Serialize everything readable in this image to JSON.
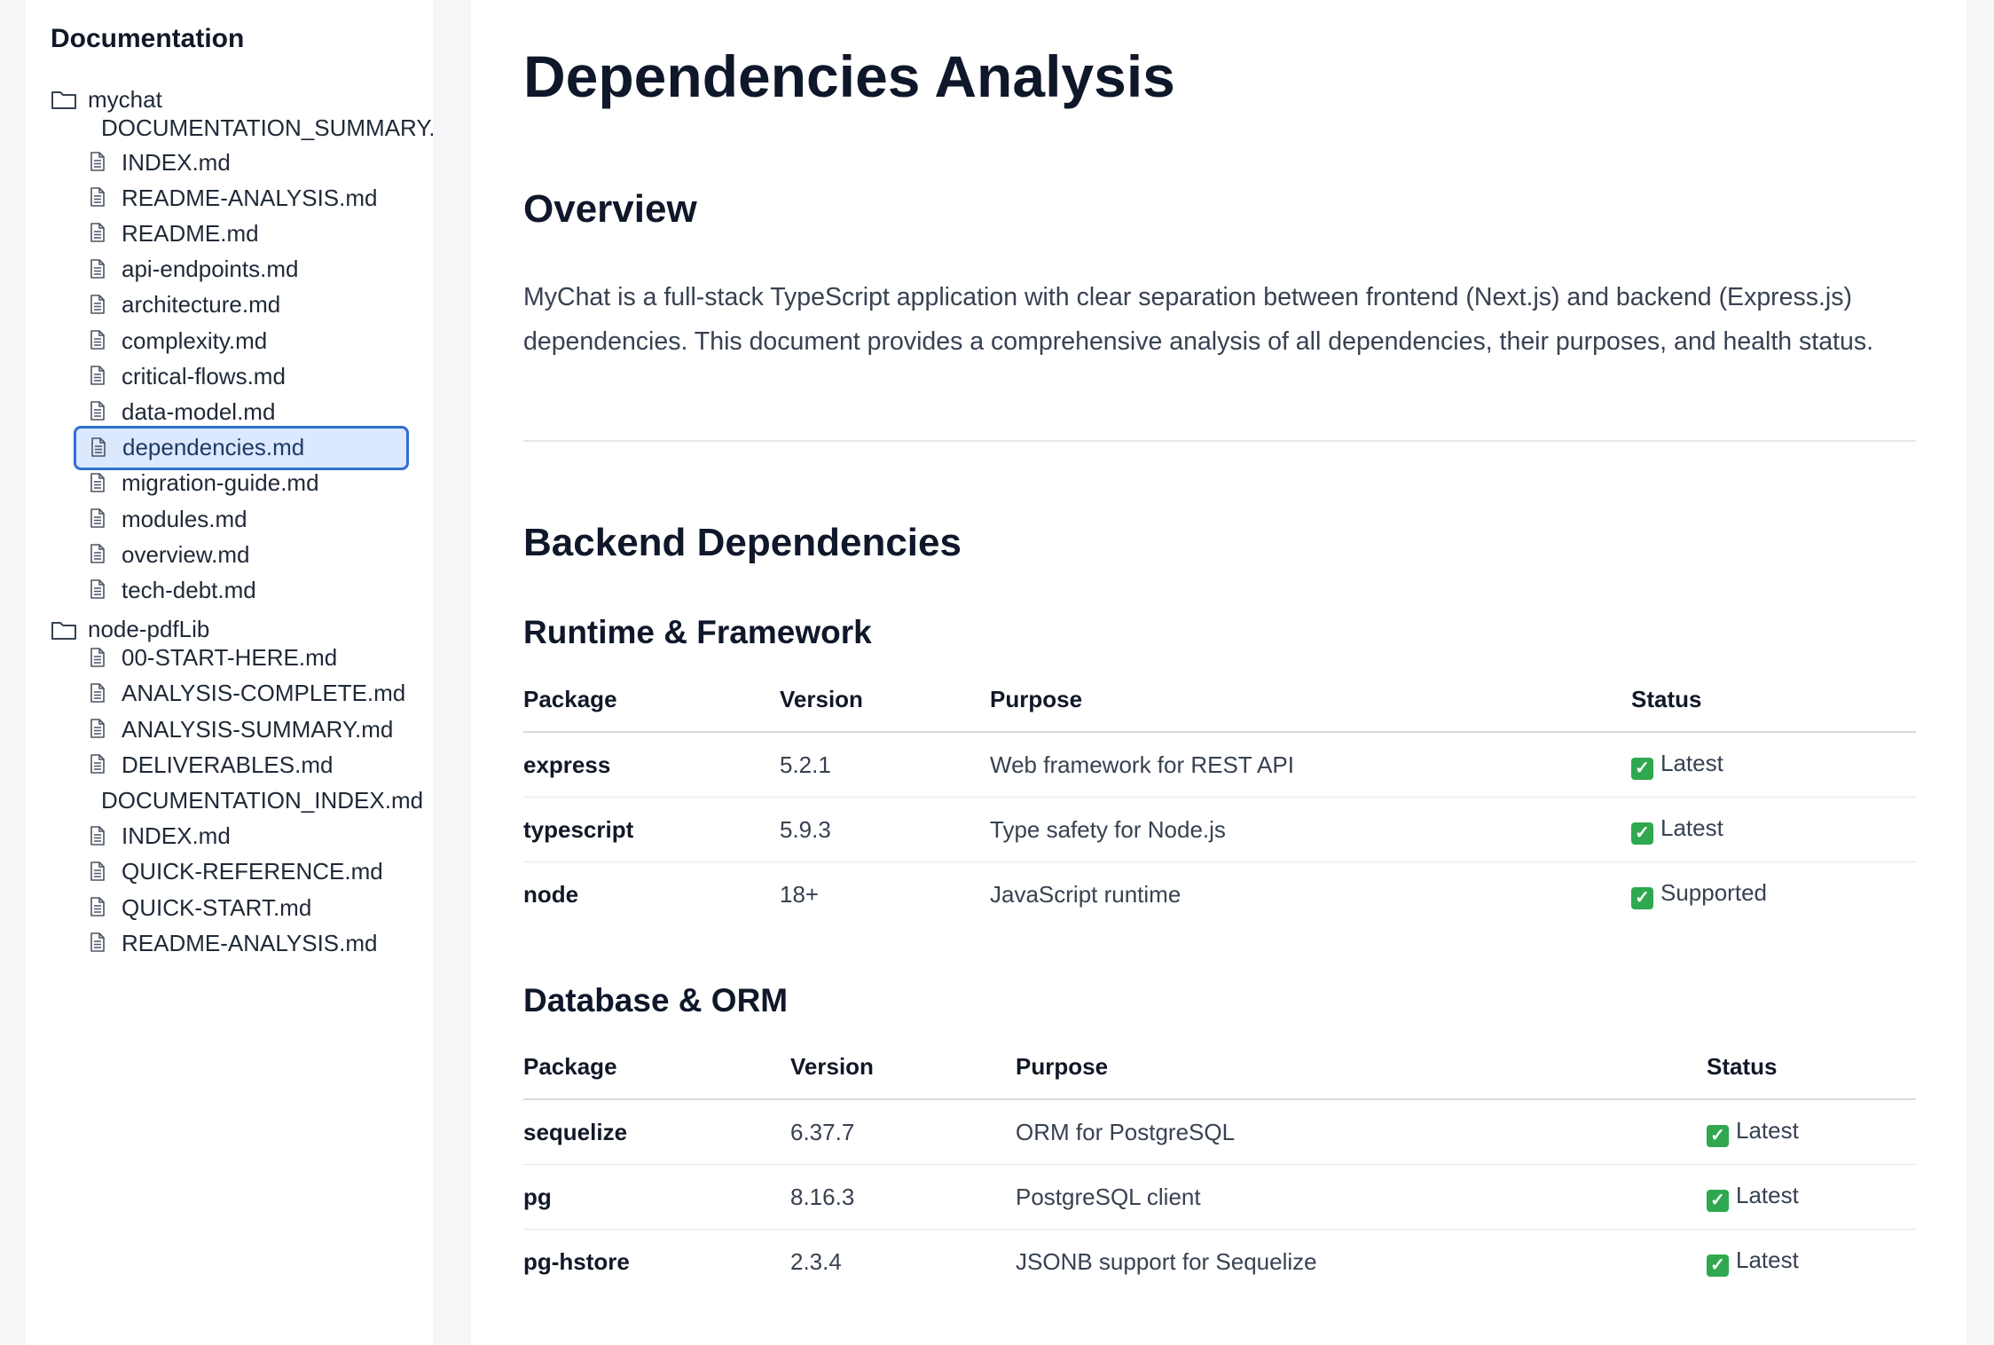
{
  "sidebar": {
    "title": "Documentation",
    "groups": [
      {
        "folder": "mychat",
        "files": [
          {
            "label": "DOCUMENTATION_SUMMARY.md",
            "icon": "none"
          },
          {
            "label": "INDEX.md",
            "icon": "file-icon"
          },
          {
            "label": "README-ANALYSIS.md",
            "icon": "file-icon"
          },
          {
            "label": "README.md",
            "icon": "file-icon"
          },
          {
            "label": "api-endpoints.md",
            "icon": "file-icon"
          },
          {
            "label": "architecture.md",
            "icon": "file-icon"
          },
          {
            "label": "complexity.md",
            "icon": "file-icon"
          },
          {
            "label": "critical-flows.md",
            "icon": "file-icon"
          },
          {
            "label": "data-model.md",
            "icon": "file-icon"
          },
          {
            "label": "dependencies.md",
            "icon": "file-icon",
            "active": true
          },
          {
            "label": "migration-guide.md",
            "icon": "file-icon"
          },
          {
            "label": "modules.md",
            "icon": "file-icon"
          },
          {
            "label": "overview.md",
            "icon": "file-icon"
          },
          {
            "label": "tech-debt.md",
            "icon": "file-icon"
          }
        ]
      },
      {
        "folder": "node-pdfLib",
        "files": [
          {
            "label": "00-START-HERE.md",
            "icon": "file-icon"
          },
          {
            "label": "ANALYSIS-COMPLETE.md",
            "icon": "file-icon"
          },
          {
            "label": "ANALYSIS-SUMMARY.md",
            "icon": "file-icon"
          },
          {
            "label": "DELIVERABLES.md",
            "icon": "file-icon"
          },
          {
            "label": "DOCUMENTATION_INDEX.md",
            "icon": "none"
          },
          {
            "label": "INDEX.md",
            "icon": "file-icon"
          },
          {
            "label": "QUICK-REFERENCE.md",
            "icon": "file-icon"
          },
          {
            "label": "QUICK-START.md",
            "icon": "file-icon"
          },
          {
            "label": "README-ANALYSIS.md",
            "icon": "file-icon"
          }
        ]
      }
    ]
  },
  "main": {
    "title": "Dependencies Analysis",
    "overview_heading": "Overview",
    "overview_text": "MyChat is a full-stack TypeScript application with clear separation between frontend (Next.js) and backend (Express.js) dependencies. This document provides a comprehensive analysis of all dependencies, their purposes, and health status.",
    "backend_heading": "Backend Dependencies",
    "headers": {
      "package": "Package",
      "version": "Version",
      "purpose": "Purpose",
      "status": "Status"
    },
    "runtime": {
      "heading": "Runtime & Framework",
      "rows": [
        {
          "package": "express",
          "version": "5.2.1",
          "purpose": "Web framework for REST API",
          "status": "Latest"
        },
        {
          "package": "typescript",
          "version": "5.9.3",
          "purpose": "Type safety for Node.js",
          "status": "Latest"
        },
        {
          "package": "node",
          "version": "18+",
          "purpose": "JavaScript runtime",
          "status": "Supported"
        }
      ]
    },
    "database": {
      "heading": "Database & ORM",
      "rows": [
        {
          "package": "sequelize",
          "version": "6.37.7",
          "purpose": "ORM for PostgreSQL",
          "status": "Latest"
        },
        {
          "package": "pg",
          "version": "8.16.3",
          "purpose": "PostgreSQL client",
          "status": "Latest"
        },
        {
          "package": "pg-hstore",
          "version": "2.3.4",
          "purpose": "JSONB support for Sequelize",
          "status": "Latest"
        }
      ]
    },
    "status_icon": "check-icon",
    "colors": {
      "accent": "#2f6fd0",
      "active_bg": "#dbe8fd",
      "check": "#2fa84f"
    }
  }
}
